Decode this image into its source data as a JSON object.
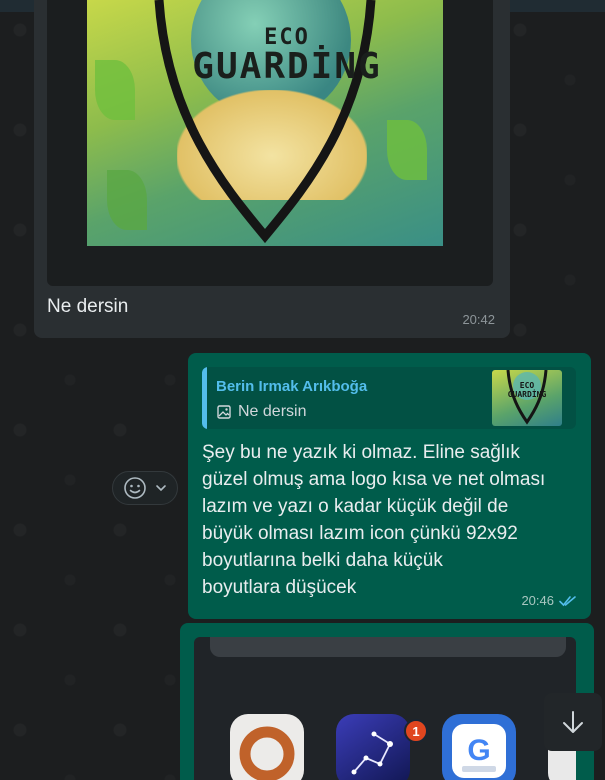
{
  "incoming": {
    "poster_text": "ECO",
    "poster_title": "GUARDİNG",
    "caption": "Ne dersin",
    "time": "20:42"
  },
  "reply": {
    "quote_author": "Berin Irmak Arıkboğa",
    "quote_text": "Ne dersin",
    "quote_icon": "image-icon",
    "thumb_text": "ECO GUARDİNG",
    "lines": [
      "Şey bu ne yazık ki olmaz. Eline sağlık",
      "güzel olmuş ama logo kısa ve net olması",
      "lazım ve yazı o kadar küçük değil de",
      "büyük olması lazım icon çünkü 92x92",
      "boyutlarına belki daha küçük",
      "boyutlara düşücek"
    ],
    "time": "20:46",
    "status_icon": "double-check-icon",
    "status_color": "#53bdeb"
  },
  "reaction": {
    "icon": "emoji-icon",
    "chevron": "chevron-down-icon"
  },
  "next_message": {
    "badge_count": "1"
  },
  "colors": {
    "outgoing_bubble": "#005c4b",
    "incoming_bubble": "#2a2f32",
    "quote_accent": "#53bdeb"
  },
  "scroll_button": {
    "icon": "arrow-down-icon"
  }
}
